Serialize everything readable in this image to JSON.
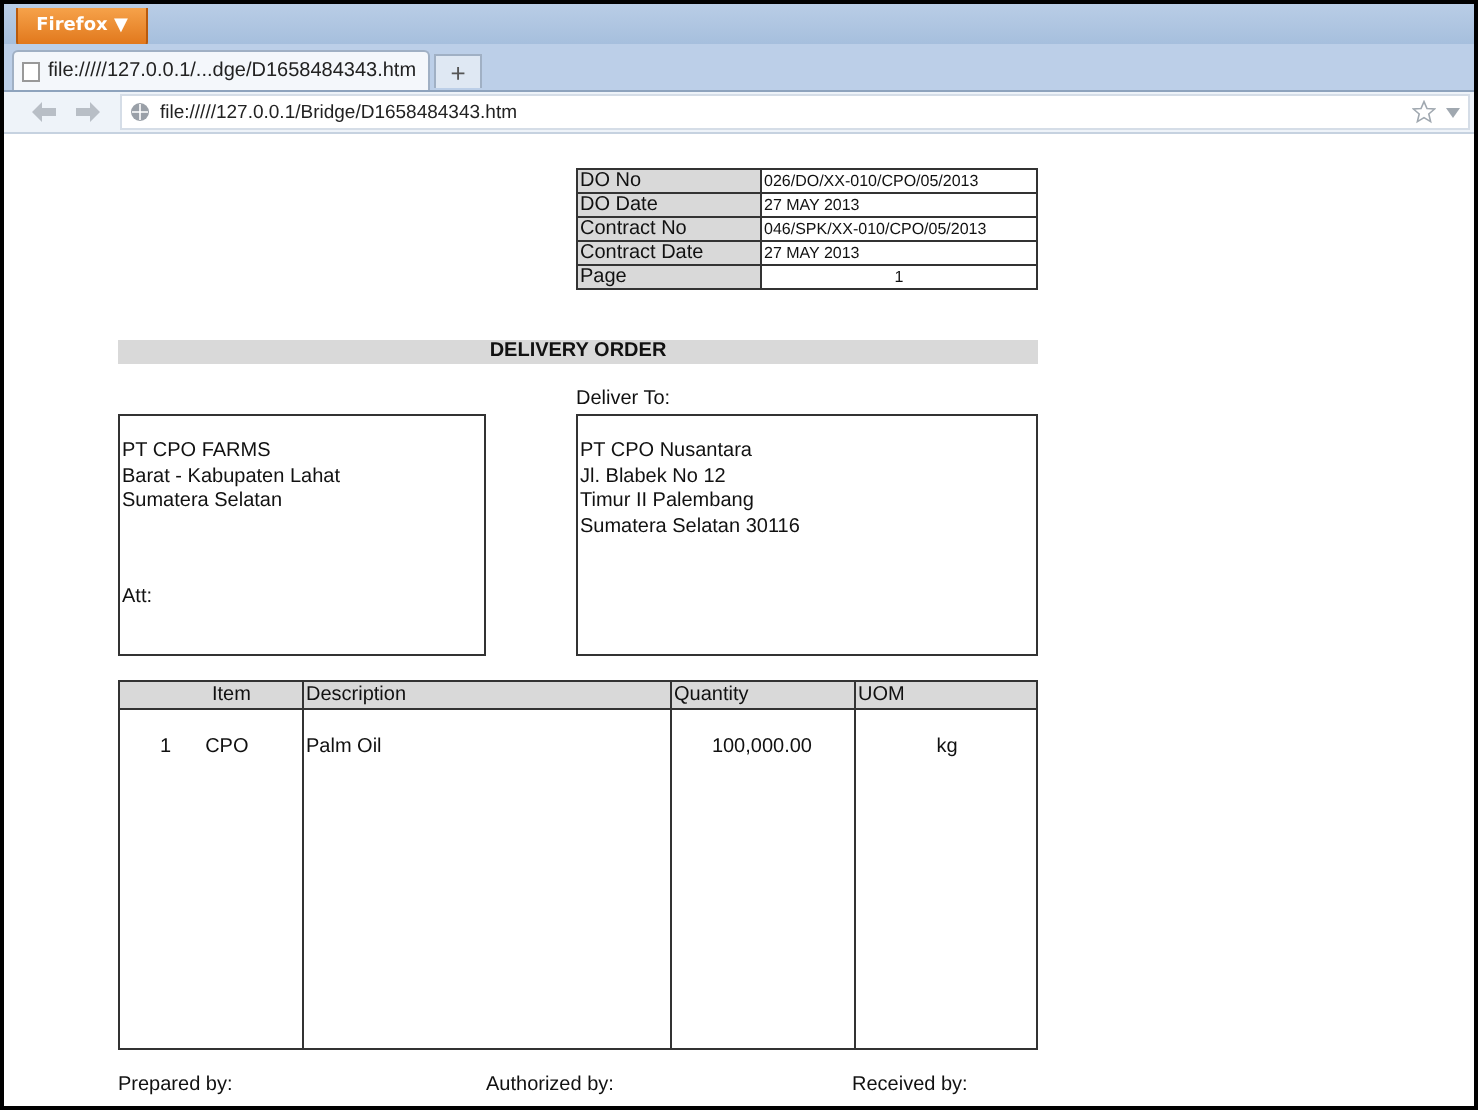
{
  "browser": {
    "menu_button": "Firefox ▼",
    "tab": {
      "title": "file://///127.0.0.1/...dge/D1658484343.htm",
      "selected": true
    },
    "new_tab": "+",
    "address": "file://///127.0.0.1/Bridge/D1658484343.htm"
  },
  "info": [
    {
      "label": "DO No",
      "value": "026/DO/XX-010/CPO/05/2013"
    },
    {
      "label": "DO Date",
      "value": "27 MAY 2013"
    },
    {
      "label": "Contract No",
      "value": "046/SPK/XX-010/CPO/05/2013"
    },
    {
      "label": "Contract Date",
      "value": "27 MAY 2013"
    },
    {
      "label": "Page",
      "value": "1"
    }
  ],
  "title": "DELIVERY ORDER",
  "deliver_to_label": "Deliver To:",
  "sender": {
    "lines": [
      "PT CPO FARMS",
      "Barat - Kabupaten Lahat",
      "Sumatera Selatan"
    ],
    "att": "Att:"
  },
  "recipient": {
    "lines": [
      "PT CPO Nusantara",
      "Jl. Blabek No 12",
      "Timur II Palembang",
      "Sumatera Selatan 30116"
    ]
  },
  "table": {
    "columns": [
      "Item",
      "Description",
      "Quantity",
      "UOM"
    ],
    "rows": [
      {
        "no": "1",
        "item": "CPO",
        "description": "Palm Oil",
        "quantity": "100,000.00",
        "uom": "kg"
      }
    ]
  },
  "signatures": [
    "Prepared by:",
    "Authorized by:",
    "Received by:"
  ]
}
